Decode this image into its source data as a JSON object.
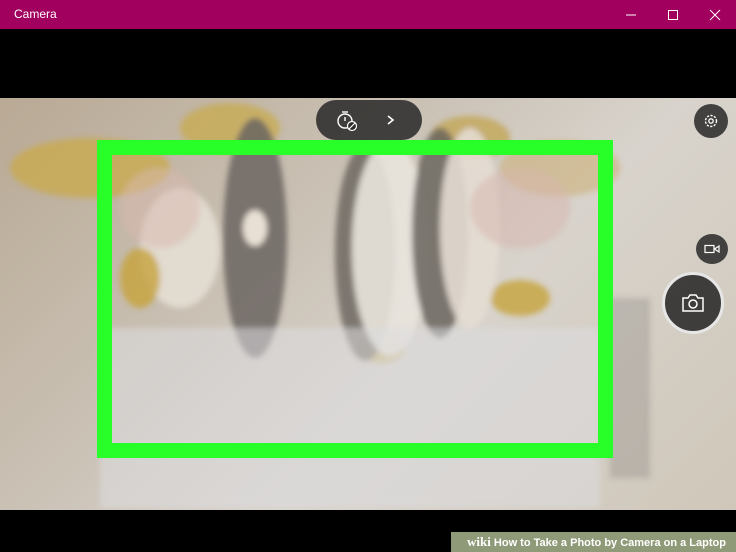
{
  "window": {
    "title": "Camera",
    "controls": {
      "minimize": "minimize-icon",
      "maximize": "maximize-icon",
      "close": "close-icon"
    }
  },
  "toolbar": {
    "timer_icon": "timer-off-icon",
    "expand_icon": "chevron-right-icon",
    "settings_icon": "gear-icon"
  },
  "capture": {
    "video_icon": "video-camera-icon",
    "photo_icon": "camera-icon"
  },
  "highlight": {
    "color": "#28ff28"
  },
  "watermark": {
    "brand": "wiki",
    "title": "How to Take a Photo by Camera on a Laptop"
  },
  "colors": {
    "titlebar": "#a1005e",
    "letterbox": "#000000"
  }
}
